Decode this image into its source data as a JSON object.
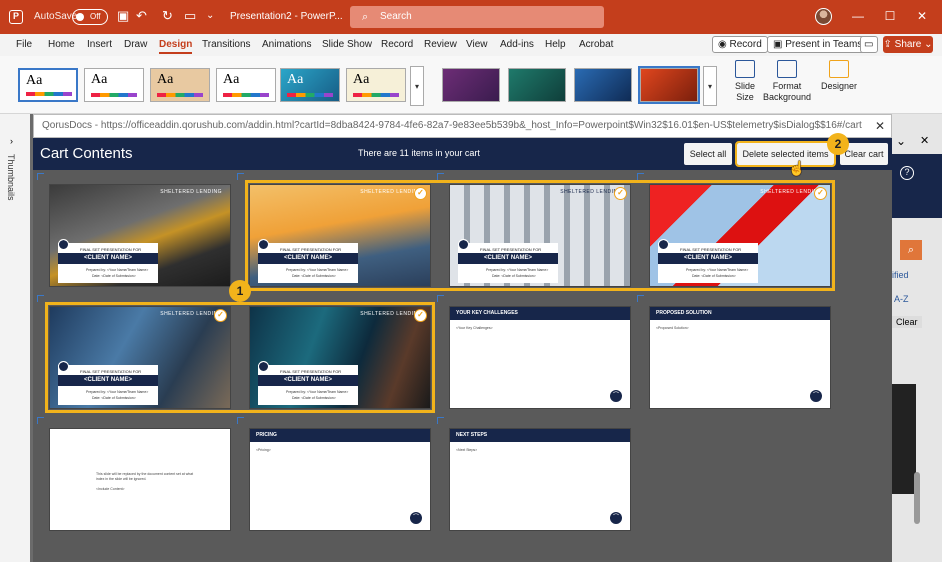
{
  "titlebar": {
    "autosave_label": "AutoSave",
    "autosave_state": "Off",
    "document_title": "Presentation2 - PowerP...",
    "search_placeholder": "Search"
  },
  "ribbon_tabs": [
    "File",
    "Home",
    "Insert",
    "Draw",
    "Design",
    "Transitions",
    "Animations",
    "Slide Show",
    "Record",
    "Review",
    "View",
    "Add-ins",
    "Help",
    "Acrobat"
  ],
  "active_tab": "Design",
  "ribbon_actions": {
    "record": "Record",
    "present_in_teams": "Present in Teams",
    "share": "Share"
  },
  "ribbon": {
    "theme_glyph": "Aa",
    "slide_size": "Slide Size",
    "format_background": "Format Background",
    "designer": "Designer"
  },
  "thumbnails_label": "Thumbnails",
  "dialog": {
    "window_title": "QorusDocs - https://officeaddin.qorushub.com/addin.html?cartId=8dba8424-9784-4fe6-82a7-9e83ee5b539b&_host_Info=Powerpoint$Win32$16.01$en-US$telemetry$isDialog$$16#/cart",
    "heading": "Cart Contents",
    "count_text": "There are 11 items in your cart",
    "select_all": "Select all",
    "delete_selected": "Delete selected items",
    "clear_cart": "Clear cart"
  },
  "slide_text": {
    "brand": "SHELTERED LENDING",
    "final_presentation": "FINAL SET PRESENTATION FOR",
    "client_name": "<CLIENT NAME>",
    "prepared_by": "Prepared by: <Your Name/Team Name>",
    "date": "Date: <Date of Submission>"
  },
  "slides": [
    {
      "kind": "title",
      "selected": false
    },
    {
      "kind": "title",
      "selected": true
    },
    {
      "kind": "title",
      "selected": true
    },
    {
      "kind": "title",
      "selected": true
    },
    {
      "kind": "title",
      "selected": true
    },
    {
      "kind": "title",
      "selected": true
    },
    {
      "kind": "section",
      "title": "YOUR KEY CHALLENGES",
      "placeholder": "<Your Key Challenges>",
      "selected": false
    },
    {
      "kind": "section",
      "title": "PROPOSED SOLUTION",
      "placeholder": "<Proposed Solution>",
      "selected": false
    },
    {
      "kind": "note",
      "line1": "This slide will be replaced by the document content set at what index in the slide will be ignored.",
      "line2": "<Include Content>",
      "selected": false
    },
    {
      "kind": "section",
      "title": "PRICING",
      "placeholder": "<Pricing>",
      "selected": false
    },
    {
      "kind": "section",
      "title": "NEXT STEPS",
      "placeholder": "<Next Steps>",
      "selected": false
    }
  ],
  "badges": [
    "1",
    "2"
  ],
  "right_pane": {
    "filtered": "ified",
    "sort": "A-Z",
    "clear": "Clear"
  },
  "colors": {
    "ppt_red": "#c43e1c",
    "navy": "#17264a",
    "highlight": "#f2b31b"
  }
}
